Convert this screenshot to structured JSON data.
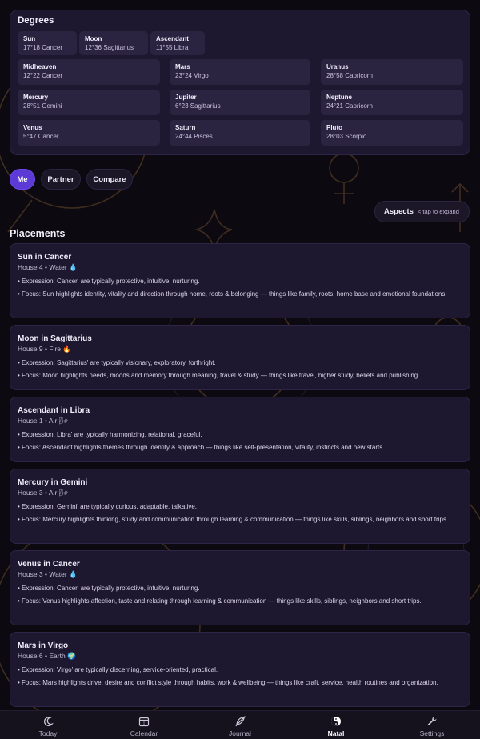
{
  "degrees": {
    "title": "Degrees",
    "primary": [
      {
        "name": "Sun",
        "value": "17°18 Cancer"
      },
      {
        "name": "Moon",
        "value": "12°36 Sagittarius"
      },
      {
        "name": "Ascendant",
        "value": "11°55 Libra"
      }
    ],
    "grid": [
      {
        "name": "Midheaven",
        "value": "12°22 Cancer"
      },
      {
        "name": "Mars",
        "value": "23°24 Virgo"
      },
      {
        "name": "Uranus",
        "value": "28°58 Capricorn"
      },
      {
        "name": "Mercury",
        "value": "28°51 Gemini"
      },
      {
        "name": "Jupiter",
        "value": "6°23 Sagittarius"
      },
      {
        "name": "Neptune",
        "value": "24°21 Capricorn"
      },
      {
        "name": "Venus",
        "value": "5°47 Cancer"
      },
      {
        "name": "Saturn",
        "value": "24°44 Pisces"
      },
      {
        "name": "Pluto",
        "value": "28°03 Scorpio"
      }
    ]
  },
  "view_toggle": {
    "me": "Me",
    "partner": "Partner",
    "compare": "Compare",
    "selected": "Me"
  },
  "aspects": {
    "label": "Aspects",
    "hint": "< tap to expand"
  },
  "placements": {
    "title": "Placements",
    "items": [
      {
        "title": "Sun in Cancer",
        "house": "House 4 • Water 💧",
        "expression": "• Expression: Cancer' are typically protective, intuitive, nurturing.",
        "focus": "• Focus: Sun highlights identity, vitality and direction through home, roots & belonging — things like family, roots, home base and emotional foundations."
      },
      {
        "title": "Moon in Sagittarius",
        "house": "House 9 • Fire 🔥",
        "expression": "• Expression: Sagittarius' are typically visionary, exploratory, forthright.",
        "focus": "• Focus: Moon highlights needs, moods and memory through meaning, travel & study — things like travel, higher study, beliefs and publishing."
      },
      {
        "title": "Ascendant in Libra",
        "house": "House 1 • Air 🌬",
        "expression": "• Expression: Libra' are typically harmonizing, relational, graceful.",
        "focus": "• Focus: Ascendant highlights themes through identity & approach — things like self-presentation, vitality, instincts and new starts."
      },
      {
        "title": "Mercury in Gemini",
        "house": "House 3 • Air 🌬",
        "expression": "• Expression: Gemini' are typically curious, adaptable, talkative.",
        "focus": "• Focus: Mercury highlights thinking, study and communication through learning & communication — things like skills, siblings, neighbors and short trips."
      },
      {
        "title": "Venus in Cancer",
        "house": "House 3 • Water 💧",
        "expression": "• Expression: Cancer' are typically protective, intuitive, nurturing.",
        "focus": "• Focus: Venus highlights affection, taste and relating through learning & communication — things like skills, siblings, neighbors and short trips."
      },
      {
        "title": "Mars in Virgo",
        "house": "House 6 • Earth 🌍",
        "expression": "• Expression: Virgo' are typically discerning, service-oriented, practical.",
        "focus": "• Focus: Mars highlights drive, desire and conflict style through habits, work & wellbeing — things like craft, service, health routines and organization."
      }
    ]
  },
  "tabbar": {
    "items": [
      {
        "label": "Today",
        "icon": "moon-icon"
      },
      {
        "label": "Calendar",
        "icon": "calendar-icon"
      },
      {
        "label": "Journal",
        "icon": "feather-icon"
      },
      {
        "label": "Natal",
        "icon": "yin-yang-icon"
      },
      {
        "label": "Settings",
        "icon": "wrench-icon"
      }
    ],
    "selected": "Natal"
  },
  "colors": {
    "accent": "#5b3ad6",
    "background": "#0c0a10",
    "card": "#1d1830",
    "decoration": "#b87a3a"
  }
}
